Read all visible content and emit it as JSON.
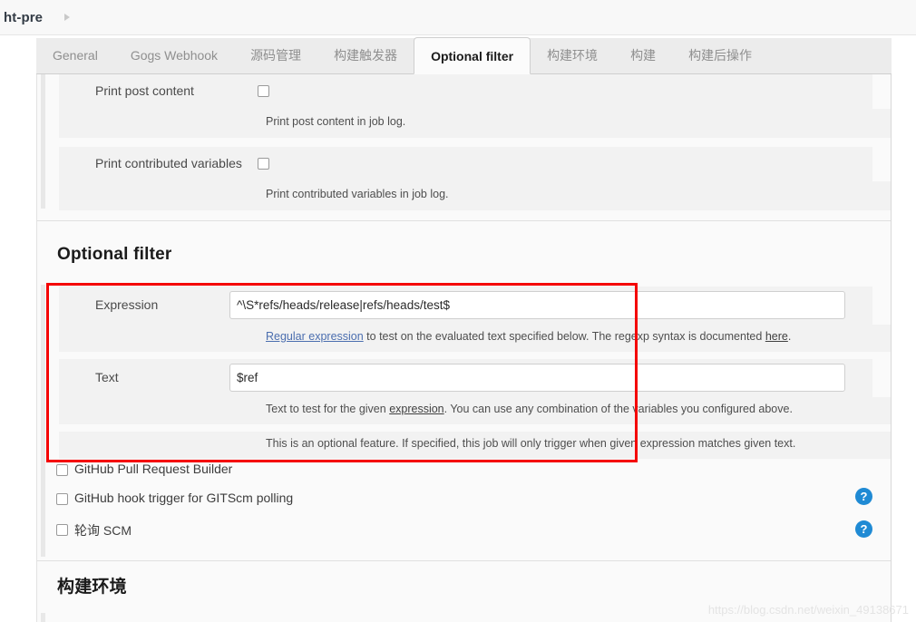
{
  "breadcrumb": {
    "items": [
      "ht-pre"
    ],
    "caret": "chevron-right-icon"
  },
  "tabs": [
    {
      "label": "General",
      "active": false
    },
    {
      "label": "Gogs Webhook",
      "active": false
    },
    {
      "label": "源码管理",
      "active": false
    },
    {
      "label": "构建触发器",
      "active": false
    },
    {
      "label": "Optional filter",
      "active": true
    },
    {
      "label": "构建环境",
      "active": false
    },
    {
      "label": "构建",
      "active": false
    },
    {
      "label": "构建后操作",
      "active": false
    }
  ],
  "settings": [
    {
      "label": "Print post content",
      "checked": false,
      "help": "Print post content in job log."
    },
    {
      "label": "Print contributed variables",
      "checked": false,
      "help": "Print contributed variables in job log."
    }
  ],
  "optional_filter": {
    "title": "Optional filter",
    "expression": {
      "label": "Expression",
      "value": "^\\S*refs/heads/release|refs/heads/test$",
      "help_prefix": "",
      "help_link1": "Regular expression",
      "help_mid": " to test on the evaluated text specified below. The regexp syntax is documented ",
      "help_link2": "here",
      "help_suffix": "."
    },
    "text": {
      "label": "Text",
      "value": "$ref",
      "help_prefix": "Text to test for the given ",
      "help_link": "expression",
      "help_suffix": ". You can use any combination of the variables you configured above."
    },
    "note": "This is an optional feature. If specified, this job will only trigger when given expression matches given text."
  },
  "trigger_checkboxes": [
    {
      "label": "GitHub Pull Request Builder",
      "checked": false,
      "help_icon": false
    },
    {
      "label": "GitHub hook trigger for GITScm polling",
      "checked": false,
      "help_icon": true
    },
    {
      "label": "轮询 SCM",
      "checked": false,
      "help_icon": true
    }
  ],
  "help_icon_glyph": "?",
  "bottom_section": {
    "title": "构建环境"
  },
  "watermark": "https://blog.csdn.net/weixin_49138671",
  "colors": {
    "accent_red": "#f40000",
    "help_blue": "#1f8ad4",
    "link_blue": "#4b6eaf"
  }
}
